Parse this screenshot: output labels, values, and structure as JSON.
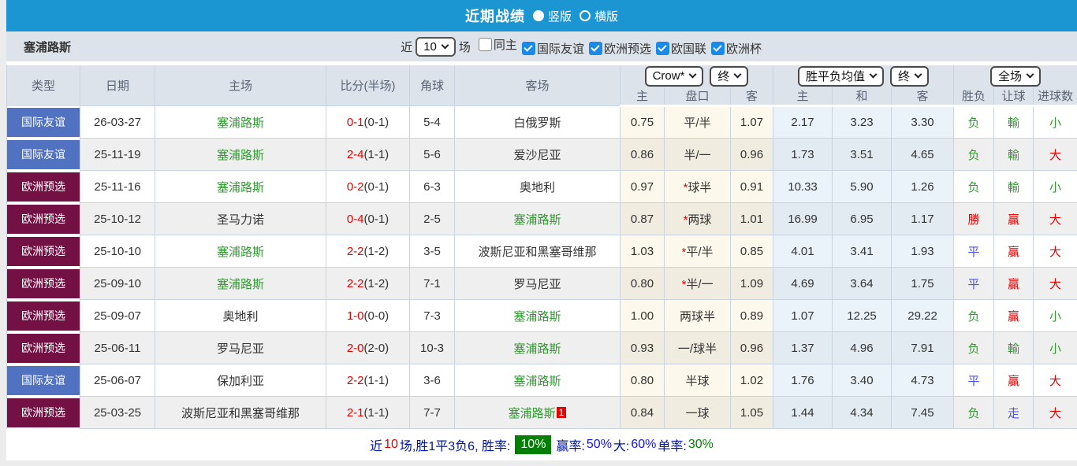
{
  "title_bar": {
    "title": "近期战绩",
    "radio_vertical": "竖版",
    "radio_horizontal": "横版"
  },
  "filter_bar": {
    "team": "塞浦路斯",
    "near_label": "近",
    "near_value": "10",
    "games_label": "场",
    "checkboxes": [
      {
        "label": "同主",
        "checked": false
      },
      {
        "label": "国际友谊",
        "checked": true
      },
      {
        "label": "欧洲预选",
        "checked": true
      },
      {
        "label": "欧国联",
        "checked": true
      },
      {
        "label": "欧洲杯",
        "checked": true
      }
    ]
  },
  "table": {
    "selects": {
      "odds_company": "Crow*",
      "odds_time": "终",
      "mean_type": "胜平负均值",
      "mean_time": "终",
      "scope": "全场"
    },
    "columns": [
      "类型",
      "日期",
      "主场",
      "比分(半场)",
      "角球",
      "客场",
      "主",
      "盘口",
      "客",
      "主",
      "和",
      "客",
      "胜负",
      "让球",
      "进球数"
    ],
    "rows": [
      {
        "type": "国际友谊",
        "type_style": "intl",
        "date": "26-03-27",
        "home": "塞浦路斯",
        "home_team": true,
        "score": "0-1",
        "half": "(0-1)",
        "corners": "5-4",
        "away": "白俄罗斯",
        "away_team": false,
        "away_badge": "",
        "crow_home": "0.75",
        "star": false,
        "handicap": "平/半",
        "crow_away": "1.07",
        "mean_home": "2.17",
        "mean_draw": "3.23",
        "mean_away": "3.30",
        "result": "负",
        "result_color": "green",
        "let_result": "輸",
        "let_color": "green",
        "goals": "小",
        "goals_color": "green"
      },
      {
        "type": "国际友谊",
        "type_style": "intl",
        "date": "25-11-19",
        "home": "塞浦路斯",
        "home_team": true,
        "score": "2-4",
        "half": "(1-1)",
        "corners": "5-6",
        "away": "爱沙尼亚",
        "away_team": false,
        "away_badge": "",
        "crow_home": "0.86",
        "star": false,
        "handicap": "半/一",
        "crow_away": "0.96",
        "mean_home": "1.73",
        "mean_draw": "3.51",
        "mean_away": "4.65",
        "result": "负",
        "result_color": "green",
        "let_result": "輸",
        "let_color": "green",
        "goals": "大",
        "goals_color": "red"
      },
      {
        "type": "欧洲预选",
        "type_style": "euro",
        "date": "25-11-16",
        "home": "塞浦路斯",
        "home_team": true,
        "score": "0-2",
        "half": "(0-1)",
        "corners": "6-3",
        "away": "奥地利",
        "away_team": false,
        "away_badge": "",
        "crow_home": "0.97",
        "star": true,
        "handicap": "球半",
        "crow_away": "0.91",
        "mean_home": "10.33",
        "mean_draw": "5.90",
        "mean_away": "1.26",
        "result": "负",
        "result_color": "green",
        "let_result": "輸",
        "let_color": "green",
        "goals": "小",
        "goals_color": "green"
      },
      {
        "type": "欧洲预选",
        "type_style": "euro",
        "date": "25-10-12",
        "home": "圣马力诺",
        "home_team": false,
        "score": "0-4",
        "half": "(0-1)",
        "corners": "2-5",
        "away": "塞浦路斯",
        "away_team": true,
        "away_badge": "",
        "crow_home": "0.87",
        "star": true,
        "handicap": "两球",
        "crow_away": "1.01",
        "mean_home": "16.99",
        "mean_draw": "6.95",
        "mean_away": "1.17",
        "result": "勝",
        "result_color": "red",
        "let_result": "贏",
        "let_color": "red",
        "goals": "大",
        "goals_color": "red"
      },
      {
        "type": "欧洲预选",
        "type_style": "euro",
        "date": "25-10-10",
        "home": "塞浦路斯",
        "home_team": true,
        "score": "2-2",
        "half": "(1-2)",
        "corners": "3-5",
        "away": "波斯尼亚和黑塞哥维那",
        "away_team": false,
        "away_badge": "",
        "crow_home": "1.03",
        "star": true,
        "handicap": "平/半",
        "crow_away": "0.85",
        "mean_home": "4.01",
        "mean_draw": "3.41",
        "mean_away": "1.93",
        "result": "平",
        "result_color": "blue",
        "let_result": "贏",
        "let_color": "red",
        "goals": "大",
        "goals_color": "red"
      },
      {
        "type": "欧洲预选",
        "type_style": "euro",
        "date": "25-09-10",
        "home": "塞浦路斯",
        "home_team": true,
        "score": "2-2",
        "half": "(1-2)",
        "corners": "7-1",
        "away": "罗马尼亚",
        "away_team": false,
        "away_badge": "",
        "crow_home": "0.80",
        "star": true,
        "handicap": "半/一",
        "crow_away": "1.09",
        "mean_home": "4.69",
        "mean_draw": "3.64",
        "mean_away": "1.75",
        "result": "平",
        "result_color": "blue",
        "let_result": "贏",
        "let_color": "red",
        "goals": "大",
        "goals_color": "red"
      },
      {
        "type": "欧洲预选",
        "type_style": "euro",
        "date": "25-09-07",
        "home": "奥地利",
        "home_team": false,
        "score": "1-0",
        "half": "(0-0)",
        "corners": "7-3",
        "away": "塞浦路斯",
        "away_team": true,
        "away_badge": "",
        "crow_home": "1.00",
        "star": false,
        "handicap": "两球半",
        "crow_away": "0.89",
        "mean_home": "1.07",
        "mean_draw": "12.25",
        "mean_away": "29.22",
        "result": "负",
        "result_color": "green",
        "let_result": "贏",
        "let_color": "red",
        "goals": "小",
        "goals_color": "green"
      },
      {
        "type": "欧洲预选",
        "type_style": "euro",
        "date": "25-06-11",
        "home": "罗马尼亚",
        "home_team": false,
        "score": "2-0",
        "half": "(2-0)",
        "corners": "10-3",
        "away": "塞浦路斯",
        "away_team": true,
        "away_badge": "",
        "crow_home": "0.93",
        "star": false,
        "handicap": "一/球半",
        "crow_away": "0.96",
        "mean_home": "1.37",
        "mean_draw": "4.96",
        "mean_away": "7.91",
        "result": "负",
        "result_color": "green",
        "let_result": "輸",
        "let_color": "green",
        "goals": "小",
        "goals_color": "green"
      },
      {
        "type": "国际友谊",
        "type_style": "intl",
        "date": "25-06-07",
        "home": "保加利亚",
        "home_team": false,
        "score": "2-2",
        "half": "(1-1)",
        "corners": "3-6",
        "away": "塞浦路斯",
        "away_team": true,
        "away_badge": "",
        "crow_home": "0.80",
        "star": false,
        "handicap": "半球",
        "crow_away": "1.02",
        "mean_home": "1.76",
        "mean_draw": "3.40",
        "mean_away": "4.73",
        "result": "平",
        "result_color": "blue",
        "let_result": "贏",
        "let_color": "red",
        "goals": "大",
        "goals_color": "red"
      },
      {
        "type": "欧洲预选",
        "type_style": "euro",
        "date": "25-03-25",
        "home": "波斯尼亚和黑塞哥维那",
        "home_team": false,
        "score": "2-1",
        "half": "(1-1)",
        "corners": "7-7",
        "away": "塞浦路斯",
        "away_team": true,
        "away_badge": "1",
        "crow_home": "0.84",
        "star": false,
        "handicap": "一球",
        "crow_away": "1.05",
        "mean_home": "1.44",
        "mean_draw": "4.34",
        "mean_away": "7.45",
        "result": "负",
        "result_color": "green",
        "let_result": "走",
        "let_color": "blue",
        "goals": "大",
        "goals_color": "red"
      }
    ]
  },
  "footer": {
    "segments": [
      {
        "text": "近",
        "style": "navy"
      },
      {
        "text": "10",
        "style": "red"
      },
      {
        "text": "场,胜1平3负6, 胜率:",
        "style": "navy"
      },
      {
        "text": "10%",
        "style": "badge"
      },
      {
        "text": "赢率:",
        "style": "navy"
      },
      {
        "text": "50%",
        "style": "blue"
      },
      {
        "text": " 大:",
        "style": "navy"
      },
      {
        "text": "60%",
        "style": "blue"
      },
      {
        "text": " 单率:",
        "style": "navy"
      },
      {
        "text": "30%",
        "style": "green"
      }
    ]
  }
}
